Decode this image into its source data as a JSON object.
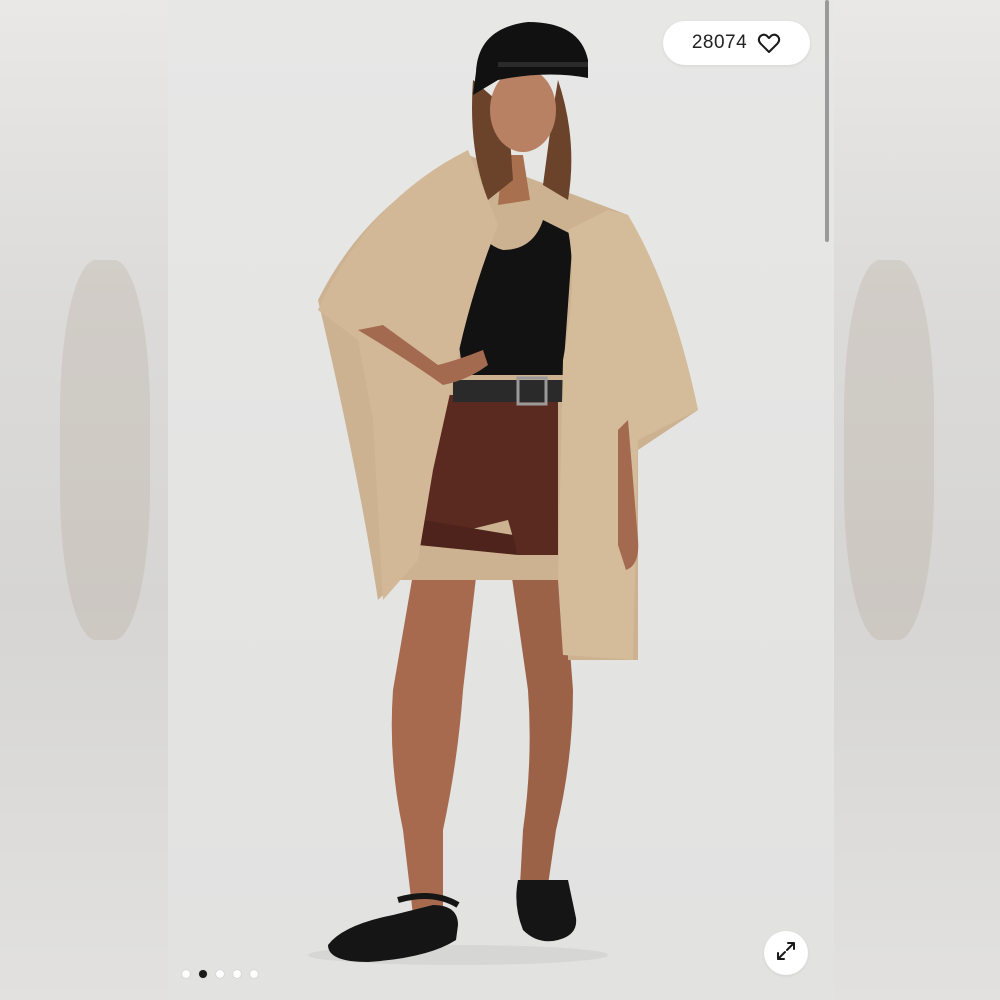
{
  "product_gallery": {
    "like_count": "28074",
    "like_icon": "heart-outline-icon",
    "expand_icon": "expand-arrows-icon",
    "pager": {
      "total": 5,
      "active_index": 1
    },
    "colors": {
      "background": "#e4e4e3",
      "cardigan": "#d2b896",
      "shorts": "#5a2a20",
      "top": "#121212",
      "active_dot": "#1a1a1a"
    }
  }
}
